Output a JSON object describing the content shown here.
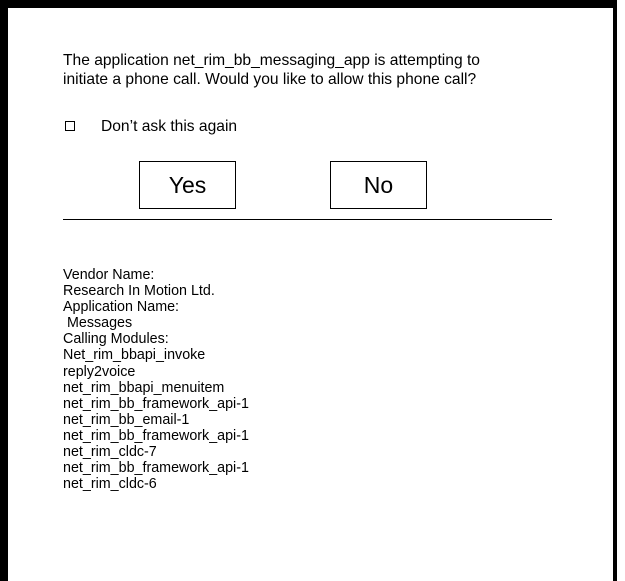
{
  "dialog": {
    "message_line1": "The application net_rim_bb_messaging_app is attempting to",
    "message_line2": "initiate a phone call. Would you like to allow this phone call?",
    "dont_ask_checked": false,
    "dont_ask_label": "Don’t ask this again",
    "yes_label": "Yes",
    "no_label": "No"
  },
  "details": {
    "vendor_heading": "Vendor Name:",
    "vendor_value": "Research In Motion Ltd.",
    "app_heading": "Application Name:",
    "app_value": " Messages",
    "modules_heading": "Calling Modules:",
    "modules": [
      "Net_rim_bbapi_invoke",
      "reply2voice",
      "net_rim_bbapi_menuitem",
      "net_rim_bb_framework_api-1",
      "net_rim_bb_email-1",
      "net_rim_bb_framework_api-1",
      "net_rim_cldc-7",
      "net_rim_bb_framework_api-1",
      "net_rim_cldc-6"
    ]
  }
}
